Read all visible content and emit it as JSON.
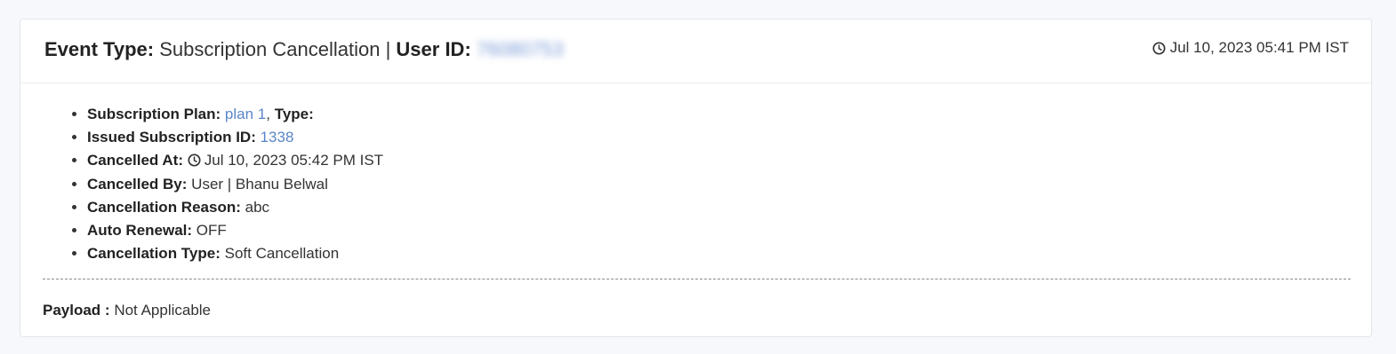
{
  "event_card": {
    "header": {
      "event_type_label": "Event Type:",
      "event_type_value": "Subscription Cancellation",
      "separator": " | ",
      "user_id_label": "User ID:",
      "user_id_value": "76080753",
      "timestamp": "Jul 10, 2023 05:41 PM IST",
      "timestamp_icon": "clock-icon"
    },
    "details": [
      {
        "label": "Subscription Plan:",
        "value": "plan 1",
        "suffix_label": "Type:",
        "link": true
      },
      {
        "label": "Issued Subscription ID:",
        "value": "1338",
        "link": true
      },
      {
        "label": "Cancelled At:",
        "value": "Jul 10, 2023 05:42 PM IST",
        "icon": "clock-icon"
      },
      {
        "label": "Cancelled By:",
        "value": "User | Bhanu Belwal"
      },
      {
        "label": "Cancellation Reason:",
        "value": "abc"
      },
      {
        "label": "Auto Renewal:",
        "value": "OFF"
      },
      {
        "label": "Cancellation Type:",
        "value": "Soft Cancellation"
      }
    ],
    "payload": {
      "label": "Payload :",
      "value": "Not Applicable"
    }
  },
  "colors": {
    "page_background": "#f6f8fb",
    "card_background": "#ffffff",
    "link": "#5b86c9",
    "text": "#333333"
  }
}
